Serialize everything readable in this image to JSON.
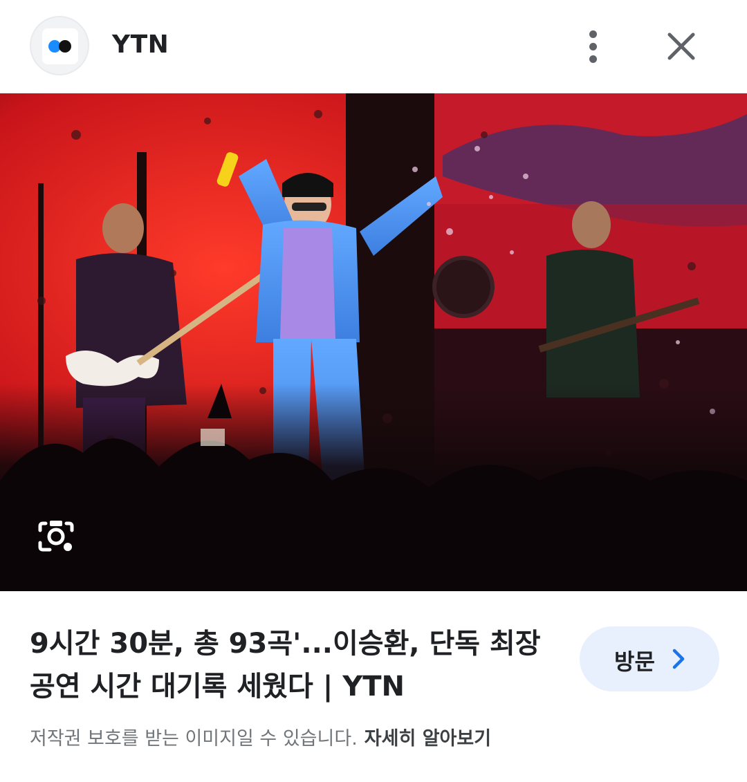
{
  "header": {
    "site_name": "YTN",
    "logo_icon": "ytn-logo-icon",
    "more_icon": "more-vert-icon",
    "close_icon": "close-icon"
  },
  "image": {
    "description_icon": "lens-search-icon"
  },
  "result": {
    "title": "9시간 30분, 총 93곡'...이승환, 단독 최장 공연 시간 대기록 세웠다 | YTN",
    "visit_label": "방문",
    "visit_icon": "chevron-right-icon"
  },
  "footer": {
    "notice": "저작권 보호를 받는 이미지일 수 있습니다.",
    "learn_more": "자세히 알아보기"
  },
  "colors": {
    "accent": "#1a73e8",
    "visit_bg": "#e8f0fe",
    "logo_blue": "#1a8cff"
  }
}
